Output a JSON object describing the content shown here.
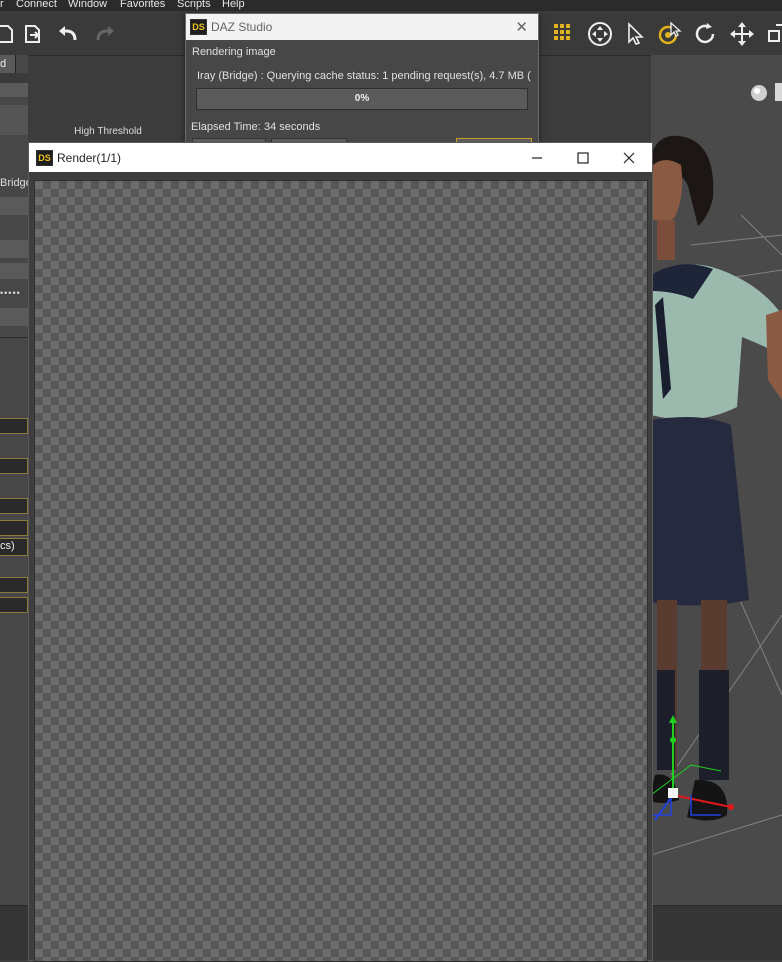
{
  "menu": {
    "items": [
      "r",
      "Connect",
      "Window",
      "Favorites",
      "Scripts",
      "Help"
    ]
  },
  "left_panel": {
    "tab_label": "d",
    "high_threshold_label": "High Threshold",
    "bridge_label": "Bridge",
    "cs_label": "cs)"
  },
  "progress_dialog": {
    "title": "DAZ Studio",
    "logo": "DS",
    "status": "Rendering image",
    "detail": "Iray (Bridge) : Querying cache status: 1 pending request(s), 4.7 MB (",
    "percent": "0%",
    "progress_fraction": 0.0,
    "elapsed_label": "Elapsed Time:",
    "elapsed_value": "34 seconds"
  },
  "render_window": {
    "title": "Render(1/1)",
    "logo": "DS",
    "minimize_icon": "minimize-icon",
    "maximize_icon": "maximize-icon",
    "close_icon": "close-icon"
  },
  "toolbar": {
    "icons": [
      "new-icon",
      "export-icon",
      "undo-icon",
      "redo-icon",
      "node-selection-icon",
      "universal-tool-icon",
      "pointer-icon",
      "rotate-pose-icon",
      "rotate-icon",
      "translate-icon",
      "scale-icon"
    ]
  },
  "colors": {
    "accent_gold": "#f0c020",
    "panel_bg": "#474747",
    "titlebar_light": "#f3f3f3"
  }
}
